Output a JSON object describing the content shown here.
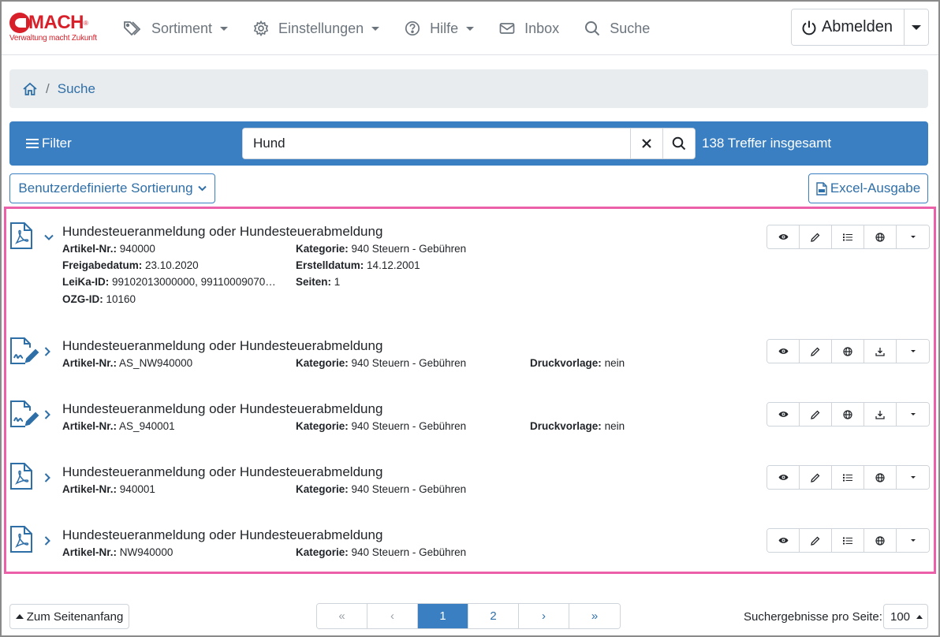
{
  "brand": {
    "name": "MACH",
    "reg": "®",
    "tagline": "Verwaltung macht Zukunft"
  },
  "nav": {
    "items": [
      {
        "label": "Sortiment",
        "icon": "tag-icon",
        "dropdown": true
      },
      {
        "label": "Einstellungen",
        "icon": "gear-icon",
        "dropdown": true
      },
      {
        "label": "Hilfe",
        "icon": "help-icon",
        "dropdown": true
      },
      {
        "label": "Inbox",
        "icon": "mail-icon",
        "dropdown": false
      },
      {
        "label": "Suche",
        "icon": "search-icon",
        "dropdown": false
      }
    ],
    "logout_label": "Abmelden"
  },
  "breadcrumb": {
    "sep": "/",
    "current": "Suche"
  },
  "filterbar": {
    "filter_label": "Filter",
    "search_value": "Hund",
    "hits": "138 Treffer insgesamt"
  },
  "toolbar": {
    "sort_label": "Benutzerdefinierte Sortierung",
    "excel_label": "Excel-Ausgabe"
  },
  "results": [
    {
      "title": "Hundesteueranmeldung oder Hundesteuerabmeldung",
      "type": "pdf",
      "expanded": true,
      "fields": {
        "artikel_label": "Artikel-Nr.:",
        "artikel": "940000",
        "kategorie_label": "Kategorie:",
        "kategorie": "940 Steuern - Gebühren",
        "freigabe_label": "Freigabedatum:",
        "freigabe": "23.10.2020",
        "erstell_label": "Erstelldatum:",
        "erstell": "14.12.2001",
        "leika_label": "LeiKa-ID:",
        "leika": "99102013000000, 99110009070…",
        "seiten_label": "Seiten:",
        "seiten": "1",
        "ozg_label": "OZG-ID:",
        "ozg": "10160"
      }
    },
    {
      "title": "Hundesteueranmeldung oder Hundesteuerabmeldung",
      "type": "form",
      "expanded": false,
      "fields": {
        "artikel_label": "Artikel-Nr.:",
        "artikel": "AS_NW940000",
        "kategorie_label": "Kategorie:",
        "kategorie": "940 Steuern - Gebühren",
        "druck_label": "Druckvorlage:",
        "druck": "nein"
      }
    },
    {
      "title": "Hundesteueranmeldung oder Hundesteuerabmeldung",
      "type": "form",
      "expanded": false,
      "fields": {
        "artikel_label": "Artikel-Nr.:",
        "artikel": "AS_940001",
        "kategorie_label": "Kategorie:",
        "kategorie": "940 Steuern - Gebühren",
        "druck_label": "Druckvorlage:",
        "druck": "nein"
      }
    },
    {
      "title": "Hundesteueranmeldung oder Hundesteuerabmeldung",
      "type": "pdf",
      "expanded": false,
      "fields": {
        "artikel_label": "Artikel-Nr.:",
        "artikel": "940001",
        "kategorie_label": "Kategorie:",
        "kategorie": "940 Steuern - Gebühren"
      }
    },
    {
      "title": "Hundesteueranmeldung oder Hundesteuerabmeldung",
      "type": "pdf",
      "expanded": false,
      "fields": {
        "artikel_label": "Artikel-Nr.:",
        "artikel": "NW940000",
        "kategorie_label": "Kategorie:",
        "kategorie": "940 Steuern - Gebühren"
      }
    }
  ],
  "footer": {
    "top_label": "Zum Seitenanfang",
    "pager": [
      "«",
      "‹",
      "1",
      "2",
      "›",
      "»"
    ],
    "per_page_label": "Suchergebnisse pro Seite:",
    "per_page_value": "100"
  },
  "colors": {
    "brand_red": "#d8202a",
    "primary": "#3a7fc1",
    "highlight": "#ec5fa9"
  }
}
